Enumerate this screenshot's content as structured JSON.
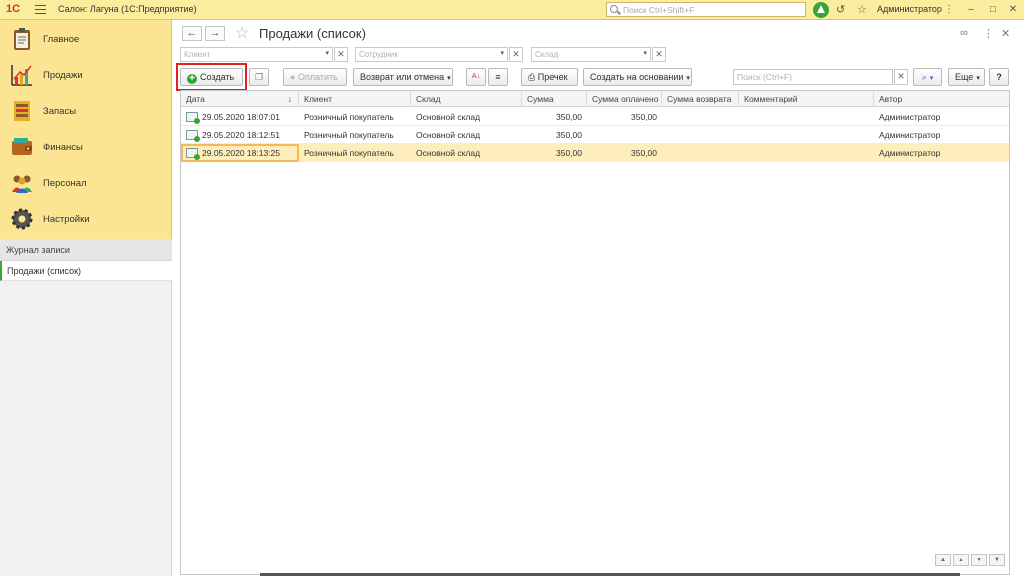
{
  "titlebar": {
    "logo": "1С",
    "app_title": "Салон: Лагуна  (1С:Предприятие)",
    "search_placeholder": "Поиск Ctrl+Shift+F",
    "user": "Администратор"
  },
  "sidebar": {
    "items": [
      {
        "label": "Главное",
        "icon": "clipboard-icon"
      },
      {
        "label": "Продажи",
        "icon": "sales-chart-icon"
      },
      {
        "label": "Запасы",
        "icon": "inventory-icon"
      },
      {
        "label": "Финансы",
        "icon": "wallet-icon"
      },
      {
        "label": "Персонал",
        "icon": "people-icon"
      },
      {
        "label": "Настройки",
        "icon": "gear-icon"
      }
    ],
    "journal_header": "Журнал записи",
    "open_item": "Продажи (список)"
  },
  "form": {
    "title": "Продажи (список)",
    "filters": {
      "client_placeholder": "Клиент",
      "employee_placeholder": "Сотрудник",
      "warehouse_placeholder": "Склад"
    },
    "toolbar": {
      "create": "Создать",
      "pay": "Оплатить",
      "return_cancel": "Возврат или отмена",
      "print": "Пречек",
      "create_based": "Создать на основании",
      "search_placeholder": "Поиск (Ctrl+F)",
      "more": "Еще",
      "help": "?"
    },
    "columns": [
      "Дата",
      "Клиент",
      "Склад",
      "Сумма",
      "Сумма оплачено",
      "Сумма возврата",
      "Комментарий",
      "Автор"
    ],
    "rows": [
      {
        "date": "29.05.2020 18:07:01",
        "client": "Розничный покупатель",
        "warehouse": "Основной склад",
        "sum": "350,00",
        "paid": "350,00",
        "returned": "",
        "comment": "",
        "author": "Администратор"
      },
      {
        "date": "29.05.2020 18:12:51",
        "client": "Розничный покупатель",
        "warehouse": "Основной склад",
        "sum": "350,00",
        "paid": "",
        "returned": "",
        "comment": "",
        "author": "Администратор"
      },
      {
        "date": "29.05.2020 18:13:25",
        "client": "Розничный покупатель",
        "warehouse": "Основной склад",
        "sum": "350,00",
        "paid": "350,00",
        "returned": "",
        "comment": "",
        "author": "Администратор"
      }
    ],
    "selected_row": 2,
    "highlight_color": "#e0211c"
  }
}
